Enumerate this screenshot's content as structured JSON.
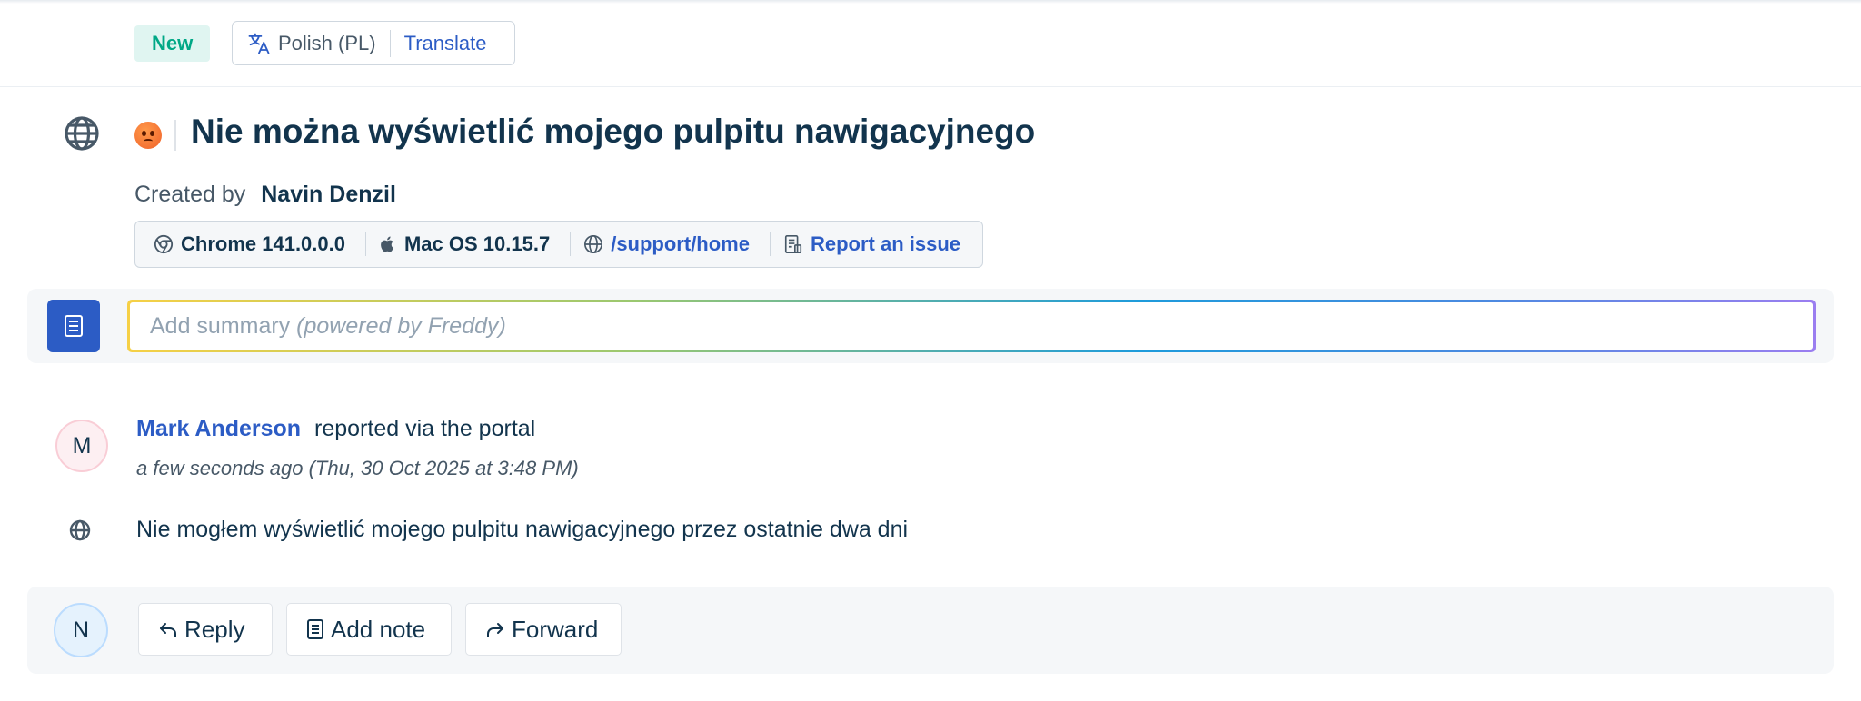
{
  "header": {
    "status_badge": "New",
    "language": "Polish (PL)",
    "translate_label": "Translate"
  },
  "ticket": {
    "title": "Nie można wyświetlić mojego pulpitu nawigacyjnego",
    "sentiment_icon": "angry-face-icon",
    "source_icon": "globe-icon",
    "created_by_label": "Created by",
    "created_by_name": "Navin Denzil"
  },
  "meta": {
    "browser": "Chrome 141.0.0.0",
    "os": "Mac OS 10.15.7",
    "path": "/support/home",
    "report_issue": "Report an issue"
  },
  "summary": {
    "placeholder": "Add summary",
    "placeholder_suffix": "(powered by Freddy)"
  },
  "conversation": {
    "avatar_initial": "M",
    "reporter_name": "Mark Anderson",
    "reported_via": "reported via the portal",
    "time": "a few seconds ago (Thu, 30 Oct 2025 at 3:48 PM)",
    "body": "Nie mogłem wyświetlić mojego pulpitu nawigacyjnego przez ostatnie dwa dni"
  },
  "reply_bar": {
    "avatar_initial": "N",
    "reply_label": "Reply",
    "note_label": "Add note",
    "forward_label": "Forward"
  },
  "colors": {
    "primary": "#2c5cc5",
    "badge_new_bg": "#e0f5f1",
    "badge_new_text": "#00a886",
    "text_dark": "#12344d",
    "text_muted": "#475867"
  }
}
